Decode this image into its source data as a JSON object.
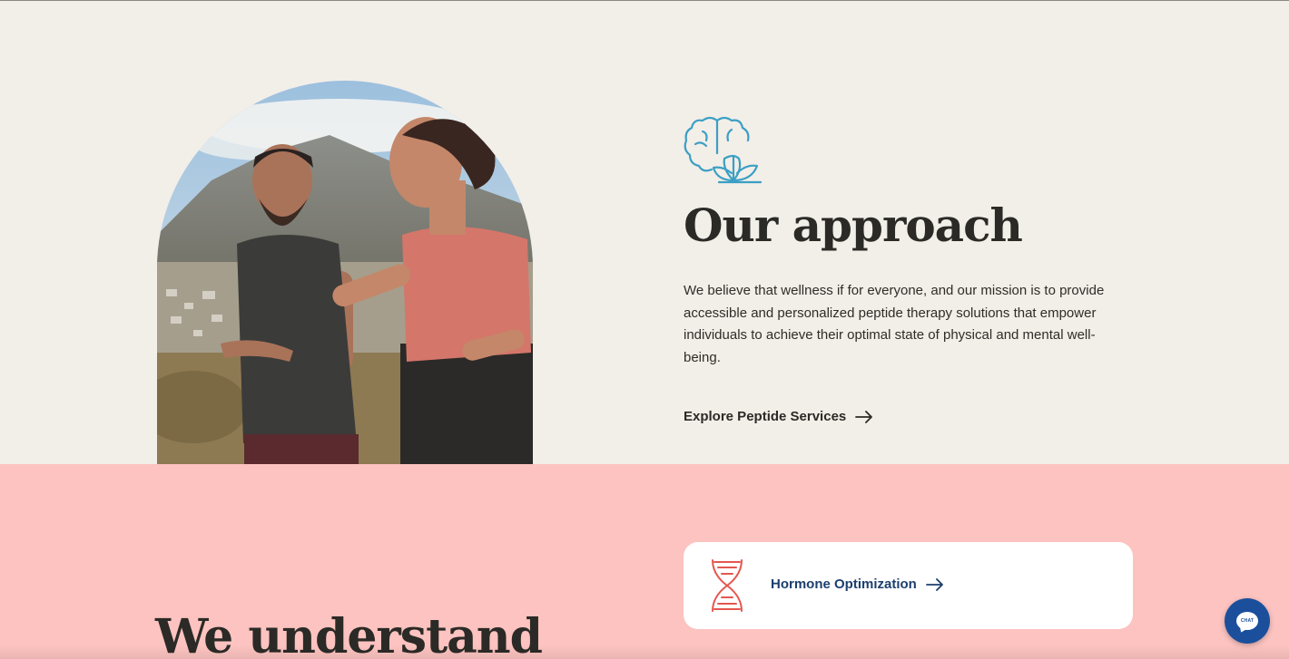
{
  "approach": {
    "title": "Our approach",
    "description": "We believe that wellness if for everyone, and our mission is to provide accessible and personalized peptide therapy solutions that empower individuals to achieve their optimal state of physical and mental well-being.",
    "cta_label": "Explore Peptide Services",
    "icon": "brain-lotus-icon",
    "accent_color": "#3b9fc4"
  },
  "understand": {
    "title": "We understand",
    "service_card": {
      "label": "Hormone Optimization",
      "icon": "dna-icon",
      "icon_color": "#e4574e",
      "label_color": "#1c3f6e"
    },
    "background_color": "#fcc3c0"
  },
  "chat": {
    "label": "CHAT",
    "color": "#1b4f9c"
  },
  "colors": {
    "page_background": "#f2eee8",
    "heading": "#2b2a26"
  }
}
